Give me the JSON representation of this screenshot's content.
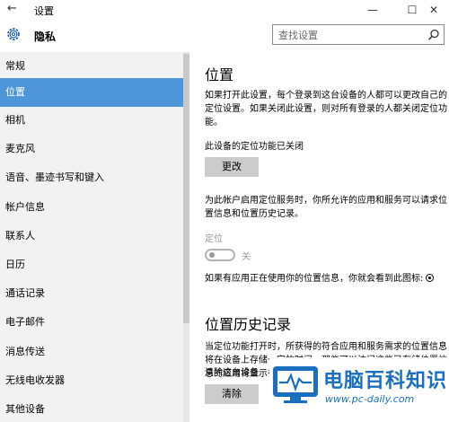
{
  "window": {
    "title": "设置",
    "back_glyph": "←",
    "min_glyph": "—",
    "max_glyph": "☐",
    "close_glyph": "✕"
  },
  "header": {
    "section_title": "隐私",
    "search_placeholder": "查找设置"
  },
  "sidebar": {
    "items": [
      {
        "label": "常规"
      },
      {
        "label": "位置"
      },
      {
        "label": "相机"
      },
      {
        "label": "麦克风"
      },
      {
        "label": "语音、墨迹书写和键入"
      },
      {
        "label": "帐户信息"
      },
      {
        "label": "联系人"
      },
      {
        "label": "日历"
      },
      {
        "label": "通话记录"
      },
      {
        "label": "电子邮件"
      },
      {
        "label": "消息传送"
      },
      {
        "label": "无线电收发器"
      },
      {
        "label": "其他设备"
      }
    ],
    "active_index": 1
  },
  "main": {
    "heading": "位置",
    "intro": "如果打开此设置，每个登录到这台设备的人都可以更改自己的定位设置。如果关闭此设置，则对所有登录的人都关闭定位功能。",
    "device_status": "此设备的定位功能已关闭",
    "change_button": "更改",
    "account_desc": "为此帐户启用定位服务时，你所允许的应用和服务可以请求位置信息和位置历史记录。",
    "location_label": "定位",
    "toggle_state": "关",
    "in_use_text": "如果有应用正在使用你的位置信息，你就会看到此图标:",
    "history_heading": "位置历史记录",
    "history_desc": "当定位功能打开时，所获得的符合应用和服务需求的位置信息将在设备上存储一定的时间。那些可以访问这些已存储位置信息的应用将显示在下面。",
    "clear_label": "清除这台设备",
    "clear_button": "清除"
  },
  "watermark": {
    "brand": "电脑百科知识",
    "url": "www.pc-daily.com"
  },
  "colors": {
    "accent": "#4f95da",
    "sidebar_bg": "#f2f2f2",
    "button_bg": "#cccccc",
    "watermark_blue": "#1a6fc0"
  },
  "icons": {
    "back": "arrow-left-icon",
    "settings": "gear-icon",
    "search": "search-icon",
    "location_in_use": "location-in-use-icon"
  }
}
